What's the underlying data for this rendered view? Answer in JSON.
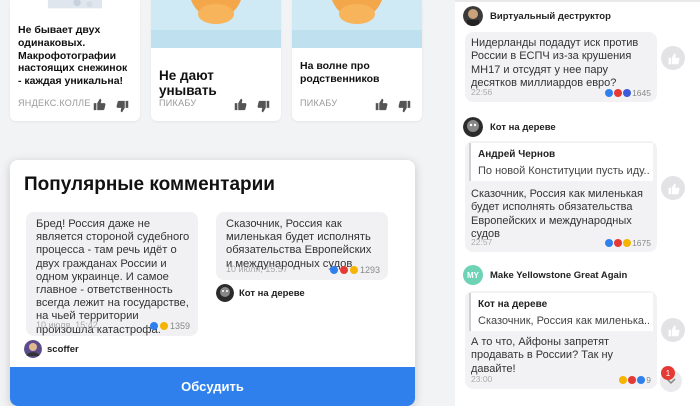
{
  "cards": [
    {
      "title": "Не бывает двух одинаковых. Макрофотографии настоящих снежинок - каждая уникальна!",
      "source": "ЯНДЕКС.КОЛЛЕК..."
    },
    {
      "title": "Не дают унывать",
      "source": "ПИКАБУ"
    },
    {
      "title": "На волне про родственников",
      "source": "ПИКАБУ"
    }
  ],
  "popular": {
    "heading": "Популярные комментарии",
    "comments": [
      {
        "text": "Бред! Россия даже не является стороной судебного процесса - там речь идёт о двух гражданах России и одном украинце. И самое главное - ответственность всегда лежит на государстве, на чьей территории произошла катастрофа.",
        "time": "10 июля, 15:42",
        "reactions": "1359",
        "author": "scoffer"
      },
      {
        "text": "Сказочник, Россия как миленькая будет исполнять обязательства Европейских и международных судов",
        "time": "10 июля, 15:57",
        "reactions": "1293",
        "author": "Кот на дереве"
      }
    ],
    "discuss_label": "Обсудить"
  },
  "sidebar": {
    "comments": [
      {
        "author": "Виртуальный деструктор",
        "text": "Нидерланды подадут иск против России в ЕСПЧ из-за крушения МН17 и отсудят у нее пару десятков миллиардов евро?",
        "time": "22:56",
        "reactions": "1645"
      },
      {
        "author": "Кот на дереве",
        "quote_author": "Андрей Чернов",
        "quote_text": "По новой Конституции пусть иду...",
        "text": "Сказочник, Россия как миленькая будет исполнять обязательства Европейских и международных судов",
        "time": "22:57",
        "reactions": "1675"
      },
      {
        "author": "Make Yellowstone Great Again",
        "avatar_initials": "MY",
        "quote_author": "Кот на дереве",
        "quote_text": "Сказочник, Россия как миленька...",
        "text": "А то что, Айфоны запретят продавать в России? Так ну давайте!",
        "time": "23:00",
        "reactions": "9"
      }
    ],
    "notification_count": "1"
  },
  "colors": {
    "accent": "#2f80ed",
    "badge": "#e53935",
    "avatar_my": "#6ed3b5"
  }
}
